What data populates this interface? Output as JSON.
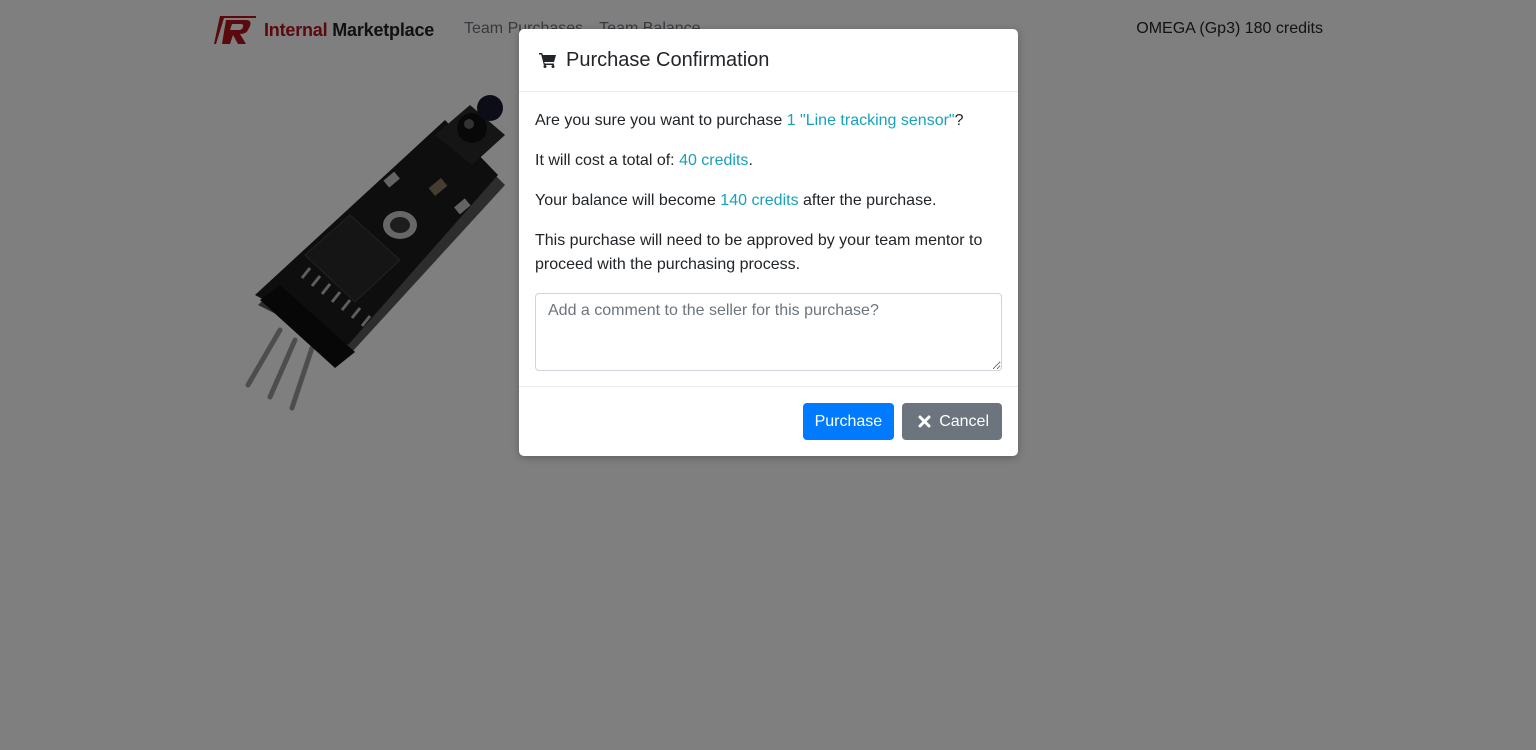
{
  "navbar": {
    "brand": {
      "word1": "Internal",
      "word2": "Marketplace",
      "logo_icon": "r-logo-icon",
      "brand_color": "#b5121b"
    },
    "links": [
      {
        "label": "Team Purchases"
      },
      {
        "label": "Team Balance"
      }
    ],
    "team_info": "OMEGA (Gp3) 180 credits"
  },
  "product": {
    "image_icon": "line-tracking-sensor-image"
  },
  "modal": {
    "title": "Purchase Confirmation",
    "title_icon": "shopping-cart-icon",
    "line1": {
      "prefix": "Are you sure you want to purchase ",
      "item": "1 \"Line tracking sensor\"",
      "suffix": "?"
    },
    "line2": {
      "prefix": "It will cost a total of: ",
      "amount": "40 credits",
      "suffix": "."
    },
    "line3": {
      "prefix": "Your balance will become ",
      "amount": "140 credits",
      "suffix": " after the purchase."
    },
    "line4": "This purchase will need to be approved by your team mentor to proceed with the purchasing process.",
    "comment": {
      "placeholder": "Add a comment to the seller for this purchase?",
      "value": ""
    },
    "buttons": {
      "purchase": "Purchase",
      "cancel": "Cancel",
      "cancel_icon": "close-icon"
    },
    "colors": {
      "highlight": "#17a2b8",
      "primary": "#007bff",
      "secondary": "#6c757d"
    }
  }
}
